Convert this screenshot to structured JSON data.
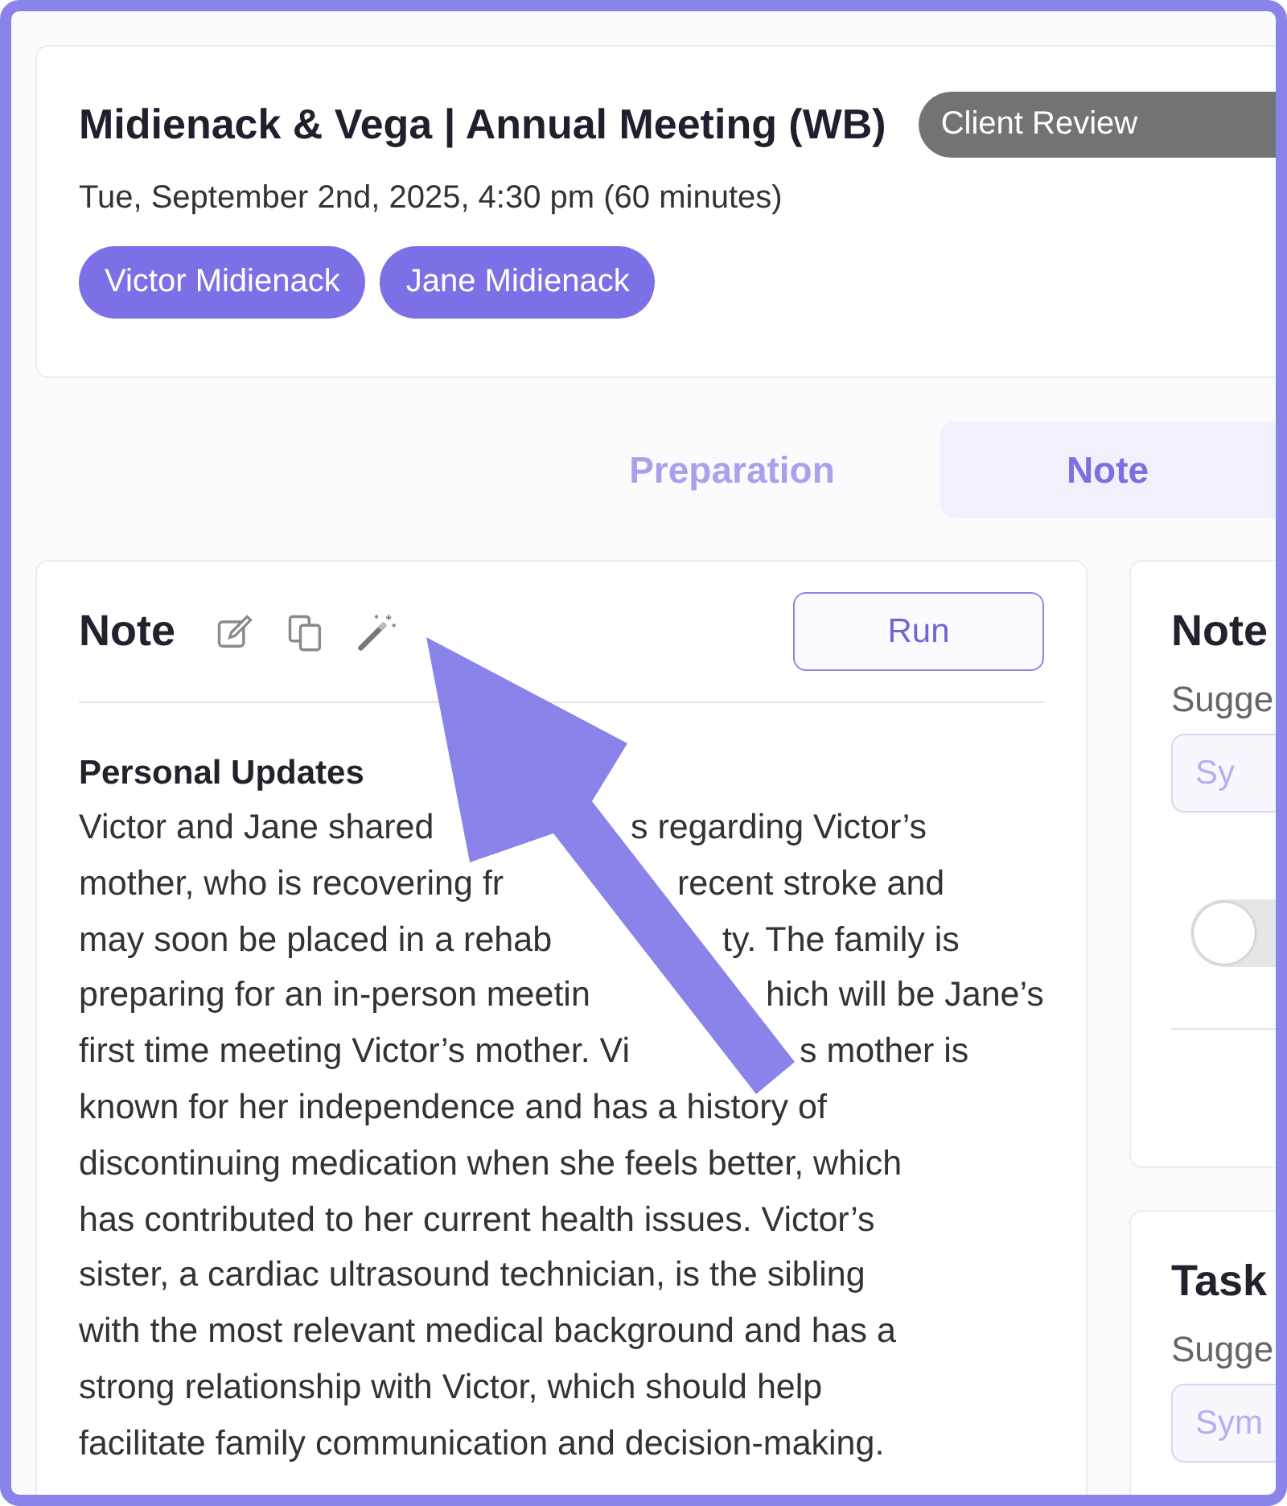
{
  "meeting": {
    "title": "Midienack & Vega | Annual Meeting (WB)",
    "status_badge": "Client Review",
    "datetime": "Tue, September 2nd, 2025, 4:30 pm (60 minutes)",
    "attendees": [
      "Victor Midienack",
      "Jane Midienack"
    ]
  },
  "tabs": [
    {
      "label": "Preparation",
      "selected": false
    },
    {
      "label": "Note",
      "selected": true
    }
  ],
  "note_panel": {
    "title": "Note",
    "run_button": "Run",
    "section_heading": "Personal Updates",
    "body_lines": [
      [
        "Victor and Jane shared",
        "s regarding Victor’s"
      ],
      [
        "mother, who is recovering fr",
        "recent stroke and"
      ],
      [
        "may soon be placed in a rehab",
        "ty. The family is"
      ],
      [
        "preparing for an in-person meetin",
        "hich will be Jane’s"
      ],
      [
        "first time meeting Victor’s mother. Vi",
        "s mother is"
      ],
      [
        "known for her independence and has a history of"
      ],
      [
        "discontinuing medication when she feels better, which"
      ],
      [
        "has contributed to her current health issues. Victor’s"
      ],
      [
        "sister, a cardiac ultrasound technician, is the sibling"
      ],
      [
        "with the most relevant medical background and has a"
      ],
      [
        "strong relationship with Victor, which should help"
      ],
      [
        "facilitate family communication and decision-making."
      ]
    ]
  },
  "side_panels": [
    {
      "title": "Note",
      "subtitle": "Sugge",
      "button": "Sy",
      "toggle": {
        "on": false
      }
    },
    {
      "title": "Task",
      "subtitle": "Sugge",
      "button": "Sym"
    }
  ]
}
